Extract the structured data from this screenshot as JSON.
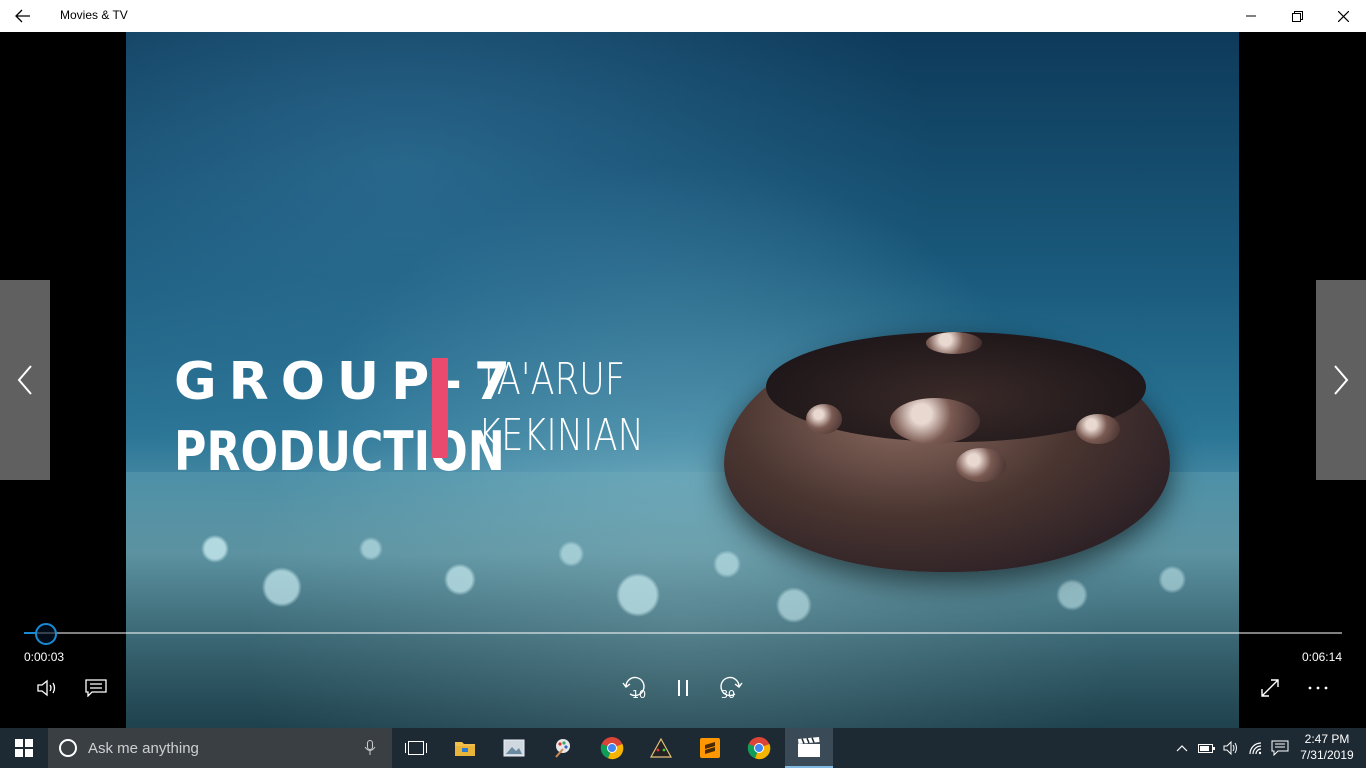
{
  "window": {
    "title": "Movies & TV"
  },
  "video": {
    "overlay_line1": "GROUP-7",
    "overlay_line2": "PRODUCTION",
    "overlay_line3": "TA'ARUF",
    "overlay_line4": "KEKINIAN",
    "accent_bar_color": "#e94a6d"
  },
  "player": {
    "current_time": "0:00:03",
    "total_time": "0:06:14",
    "progress_fraction": 0.008,
    "skip_back_label": "10",
    "skip_forward_label": "30",
    "accent_color": "#1a8ad4"
  },
  "taskbar": {
    "search_placeholder": "Ask me anything",
    "time": "2:47 PM",
    "date": "7/31/2019"
  }
}
